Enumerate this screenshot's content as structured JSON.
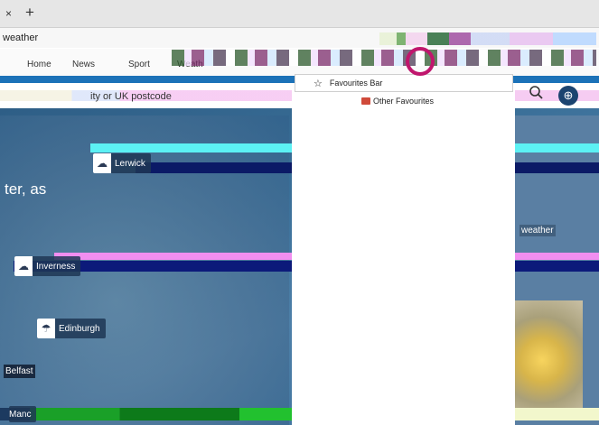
{
  "browser": {
    "tab_close_glyph": "×",
    "new_tab_glyph": "+",
    "address": "weather"
  },
  "nav": {
    "items": [
      "Home",
      "News",
      "Sport",
      "Weath"
    ]
  },
  "search": {
    "placeholder": "City or UK postcode",
    "placeholder_visible": "ity or UK postcode",
    "location_icon": "crosshair-icon"
  },
  "favourites_menu": {
    "favourites_bar_label": "Favourites Bar",
    "other_favourites_label": "Other Favourites"
  },
  "map": {
    "hero_text": "ter, as",
    "cities": [
      {
        "name": "Lerwick",
        "icon": "cloud-icon"
      },
      {
        "name": "Inverness",
        "icon": "cloud-icon"
      },
      {
        "name": "Edinburgh",
        "icon": "cloud-rain-icon"
      },
      {
        "name": "Belfast",
        "icon": ""
      },
      {
        "name": "Manc",
        "icon": ""
      }
    ],
    "side_label": "weather"
  },
  "colors": {
    "accent_blue": "#1c72b8",
    "highlight": "#c0166d"
  }
}
